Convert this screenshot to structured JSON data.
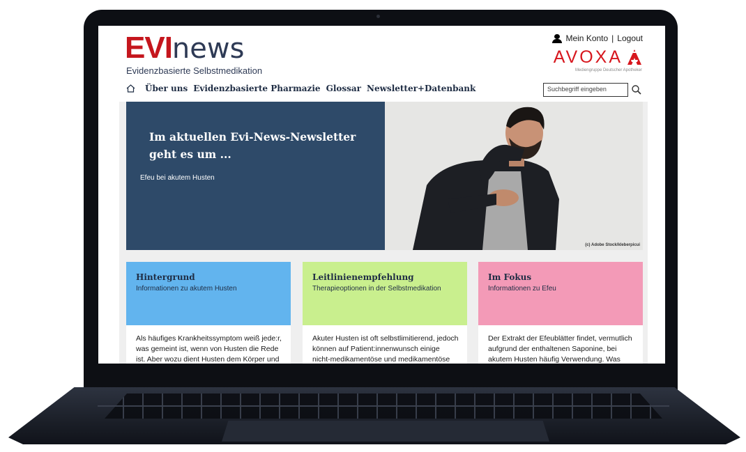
{
  "header": {
    "logo_part1": "EVI",
    "logo_part2": "news",
    "tagline": "Evidenzbasierte Selbstmedikation",
    "account_label": "Mein Konto",
    "separator": "|",
    "logout_label": "Logout",
    "partner_logo": "AVOXA",
    "partner_subline": "Mediengruppe Deutscher Apotheker"
  },
  "nav": {
    "home_icon": "home-icon",
    "items": [
      {
        "label": "Über uns"
      },
      {
        "label": "Evidenzbasierte Pharmazie"
      },
      {
        "label": "Glossar"
      },
      {
        "label": "Newsletter+Datenbank"
      }
    ]
  },
  "search": {
    "placeholder": "Suchbegriff eingeben",
    "icon": "search-icon"
  },
  "hero": {
    "title": "Im aktuellen Evi-News-Newsletter geht es um ...",
    "subtitle": "Efeu bei akutem Husten",
    "image_credit": "(c) Adobe Stock/kleberpicui",
    "color": "#2e4a69"
  },
  "cards": [
    {
      "title": "Hintergrund",
      "subtitle": "Informationen zu akutem Husten",
      "text": "Als häufiges Krankheitssymptom weiß jede:r, was gemeint ist, wenn von Husten die Rede ist. Aber wozu dient Husten dem Körper und",
      "color": "#62b4ee"
    },
    {
      "title": "Leitlinienempfehlung",
      "subtitle": "Therapieoptionen in der Selbstmedikation",
      "text": "Akuter Husten ist oft selbstlimitierend, jedoch können auf Patient:innenwunsch einige nicht-medikamentöse und medikamentöse",
      "color": "#c9ef8e"
    },
    {
      "title": "Im Fokus",
      "subtitle": "Informationen zu Efeu",
      "text": "Der Extrakt der Efeublätter findet, vermutlich aufgrund der enthaltenen Saponine, bei akutem Husten häufig Verwendung. Was",
      "color": "#f39ab7"
    }
  ]
}
